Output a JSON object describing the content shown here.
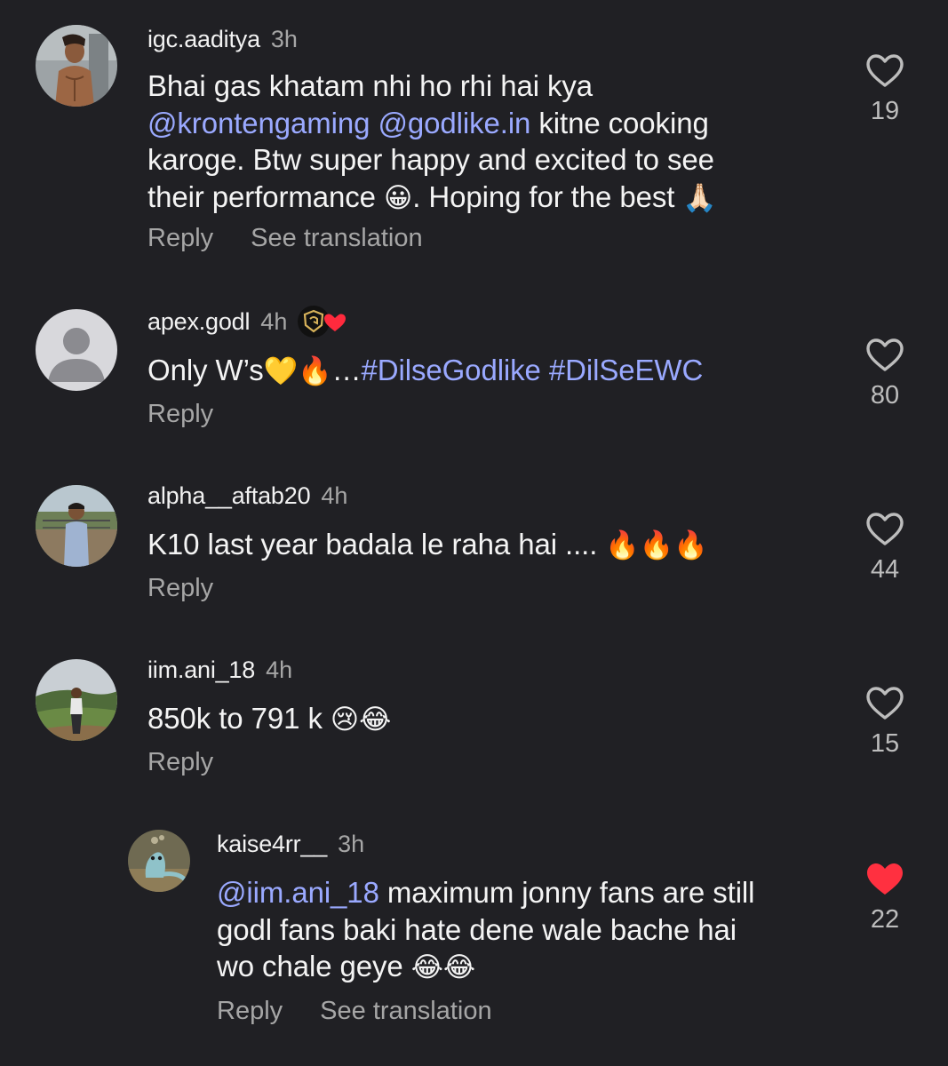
{
  "comments": [
    {
      "username": "igc.aaditya",
      "time": "3h",
      "avatar_icon": "profile-photo-shirtless-man-icon",
      "text": {
        "t1": "Bhai gas khatam nhi ho rhi hai kya",
        "m1": "@krontengaming",
        "m2": "@godlike.in",
        "t2": " kitne cooking",
        "t3": "karoge. Btw super happy and excited to see",
        "t4": "their performance ",
        "e1": "😀",
        "t5": ". Hoping for the best ",
        "e2": "🙏🏻"
      },
      "actions": {
        "reply": "Reply",
        "translate": "See translation"
      },
      "likes": "19",
      "liked": false
    },
    {
      "username": "apex.godl",
      "time": "4h",
      "avatar_icon": "default-profile-icon",
      "badge_icon": "godlike-logo-heart-badge-icon",
      "text": {
        "t1": "Only W’s",
        "e1": "💛🔥",
        "t2": "…",
        "tag1": "#DilseGodlike",
        "tag2": "#DilSeEWC"
      },
      "actions": {
        "reply": "Reply"
      },
      "likes": "80",
      "liked": false
    },
    {
      "username": "alpha__aftab20",
      "time": "4h",
      "avatar_icon": "profile-photo-man-outdoors-icon",
      "text": {
        "t1": "K10 last year badala le raha hai .... ",
        "e1": "🔥🔥🔥"
      },
      "actions": {
        "reply": "Reply"
      },
      "likes": "44",
      "liked": false
    },
    {
      "username": "iim.ani_18",
      "time": "4h",
      "avatar_icon": "profile-photo-man-hills-icon",
      "text": {
        "t1": "850k to 791 k ",
        "e1": "😢😂"
      },
      "actions": {
        "reply": "Reply"
      },
      "likes": "15",
      "liked": false
    },
    {
      "username": "kaise4rr__",
      "time": "3h",
      "avatar_icon": "profile-photo-lizard-icon",
      "text": {
        "m1": "@iim.ani_18",
        "t1": " maximum jonny fans are still",
        "t2": "godl fans baki hate dene wale bache hai",
        "t3": "wo chale geye ",
        "e1": "😂😂"
      },
      "actions": {
        "reply": "Reply",
        "translate": "See translation"
      },
      "likes": "22",
      "liked": true
    }
  ],
  "colors": {
    "background": "#202024",
    "mention": "#9aa9ff",
    "muted": "#a6a6a6",
    "like_active": "#ff3040"
  }
}
